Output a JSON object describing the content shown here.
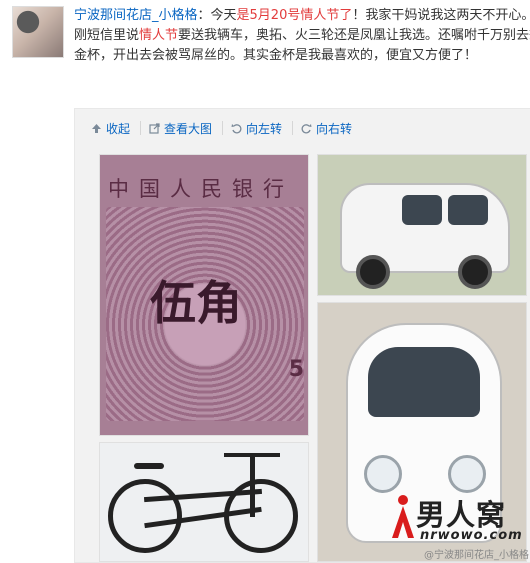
{
  "post": {
    "author": "宁波那间花店_小格格",
    "colon": "：今天",
    "date_highlight": "是5月20号情人节了",
    "text_a": "！我家干妈说我这两天不开心。刚短信里说",
    "topic": "情人节",
    "text_b": "要送我辆车，奥拓、火三轮还是凤凰让我选。还嘱咐千万别去想金杯，开出去会被骂屌丝的。其实金杯是我最喜欢的，便宜又方便了！"
  },
  "toolbar": {
    "collapse": "收起",
    "view_large": "查看大图",
    "rotate_left": "向左转",
    "rotate_right": "向右转"
  },
  "photos": {
    "banknote_header": "中国人民银行",
    "banknote_value": "伍角",
    "banknote_digit": "5"
  },
  "watermark": {
    "cn": "男人窝",
    "en": "nrwowo.com",
    "sub": "@宁波那间花店_小格格"
  },
  "colors": {
    "link": "#0a66c2",
    "highlight": "#e23c3c"
  }
}
